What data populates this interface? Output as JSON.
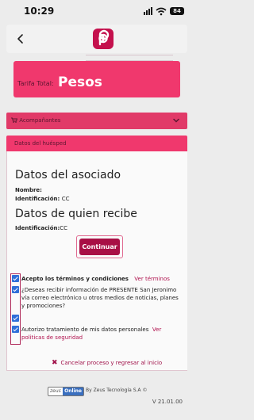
{
  "status_bar": {
    "time": "10:29",
    "battery": "84"
  },
  "tarifa": {
    "label": "Tarifa Total:",
    "value": "Pesos"
  },
  "acompanantes": {
    "label": "Acompañantes"
  },
  "huesped": {
    "header": "Datos del huésped"
  },
  "asociado": {
    "title": "Datos del asociado",
    "nombre_label": "Nombre:",
    "nombre_value": "",
    "id_label": "Identificación:",
    "id_value": "CC"
  },
  "recibe": {
    "title": "Datos de quien recibe",
    "id_label": "Identificación:",
    "id_value": "CC"
  },
  "continue_label": "Continuar",
  "consents": [
    {
      "text": "Acepto los términos y condiciones",
      "link": "Ver términos"
    },
    {
      "text": "¿Deseas recibir información de PRESENTE San Jeronimo vía correo electrónico u otros medios de noticias, planes y promociones?"
    },
    {
      "text": ""
    },
    {
      "text": "Autorizo tratamiento de mis datos personales",
      "link": "Ver politicas de seguridad"
    }
  ],
  "cancel_label": "Cancelar proceso y regresar al inicio",
  "footer": {
    "brand_word": "zeus",
    "brand_online": "Online",
    "by_text": "By Zeus Tecnología S.A ©",
    "version": "V 21.01.00"
  },
  "colors": {
    "accent": "#a80f45",
    "header_pink": "#f0386d",
    "checkbox_blue": "#2f6fd8"
  },
  "icons": [
    "signal-icon",
    "wifi-icon",
    "battery-icon",
    "back-arrow-icon",
    "app-logo-icon",
    "chevron-down-icon",
    "cart-icon",
    "checkbox-checked-icon",
    "close-x-icon"
  ]
}
